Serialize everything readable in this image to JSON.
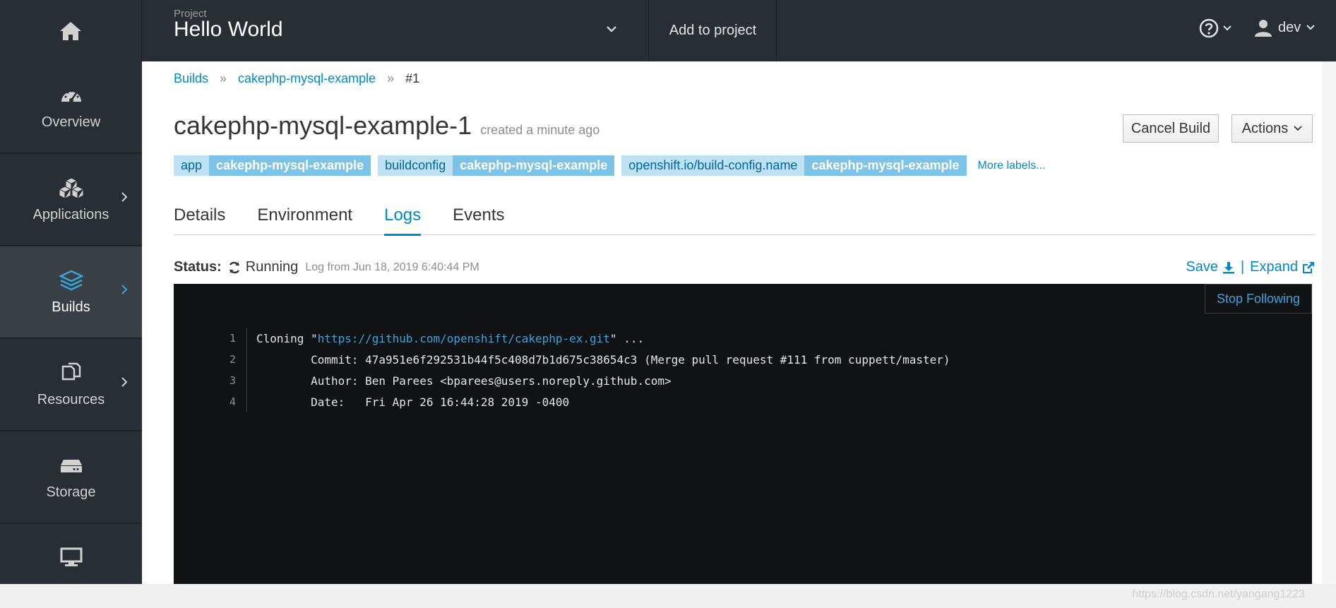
{
  "header": {
    "project_label": "Project",
    "project_name": "Hello World",
    "add_to_project": "Add to project",
    "user": "dev"
  },
  "sidebar": {
    "items": [
      {
        "label": "Overview"
      },
      {
        "label": "Applications"
      },
      {
        "label": "Builds"
      },
      {
        "label": "Resources"
      },
      {
        "label": "Storage"
      }
    ]
  },
  "breadcrumb": {
    "builds": "Builds",
    "config": "cakephp-mysql-example",
    "current": "#1"
  },
  "build": {
    "title": "cakephp-mysql-example-1",
    "created": "created a minute ago",
    "cancel": "Cancel Build",
    "actions": "Actions"
  },
  "labels": [
    {
      "key": "app",
      "value": "cakephp-mysql-example"
    },
    {
      "key": "buildconfig",
      "value": "cakephp-mysql-example"
    },
    {
      "key": "openshift.io/build-config.name",
      "value": "cakephp-mysql-example"
    }
  ],
  "more_labels": "More labels...",
  "tabs": [
    "Details",
    "Environment",
    "Logs",
    "Events"
  ],
  "status": {
    "label": "Status:",
    "value": "Running",
    "log_from": "Log from Jun 18, 2019 6:40:44 PM",
    "save": "Save",
    "separator": "|",
    "expand": "Expand"
  },
  "log": {
    "stop_following": "Stop Following",
    "lines": [
      {
        "n": "1",
        "pre": "Cloning \"",
        "url": "https://github.com/openshift/cakephp-ex.git",
        "post": "\" ..."
      },
      {
        "n": "2",
        "pre": "        Commit: 47a951e6f292531b44f5c408d7b1d675c38654c3 (Merge pull request #111 from cuppett/master)",
        "url": "",
        "post": ""
      },
      {
        "n": "3",
        "pre": "        Author: Ben Parees <bparees@users.noreply.github.com>",
        "url": "",
        "post": ""
      },
      {
        "n": "4",
        "pre": "        Date:   Fri Apr 26 16:44:28 2019 -0400",
        "url": "",
        "post": ""
      }
    ]
  },
  "watermark": "https://blog.csdn.net/yangang1223",
  "colors": {
    "topbar": "#292e34",
    "accent": "#0088ce",
    "log_bg": "#101214"
  }
}
